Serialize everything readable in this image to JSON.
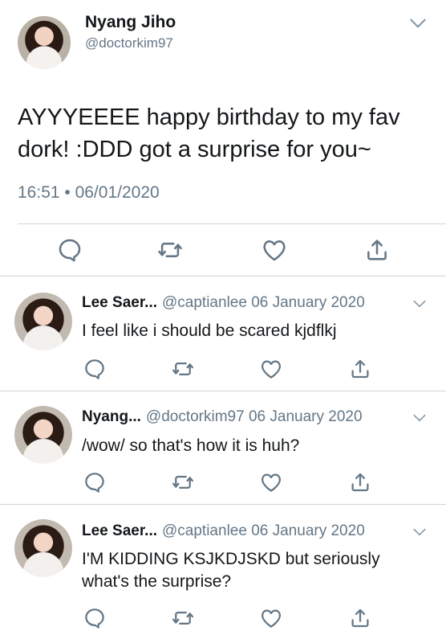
{
  "main": {
    "name": "Nyang Jiho",
    "handle": "@doctorkim97",
    "text": "AYYYEEEE happy birthday to my fav dork! :DDD got a surprise for you~",
    "timestamp": "16:51 • 06/01/2020",
    "icons": [
      "reply-icon",
      "retweet-icon",
      "like-icon",
      "share-icon"
    ]
  },
  "replies": [
    {
      "name": "Lee Saer...",
      "meta": "@captianlee 06 January 2020",
      "text": "I feel like i should be scared kjdflkj"
    },
    {
      "name": "Nyang...",
      "meta": "@doctorkim97 06 January 2020",
      "text": "/wow/ so that's how it is huh?"
    },
    {
      "name": "Lee Saer...",
      "meta": "@captianlee 06 January 2020",
      "text": "I'M KIDDING KSJKDJSKD but seriously what's the surprise?"
    }
  ],
  "colors": {
    "text": "#14171a",
    "secondary": "#657786",
    "divider": "#ccd6dd",
    "icon": "#657786"
  }
}
